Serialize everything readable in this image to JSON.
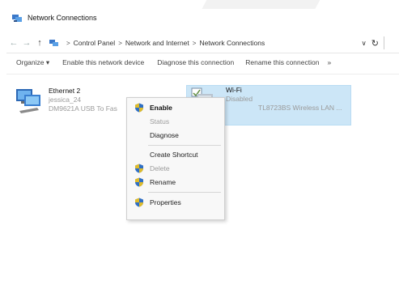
{
  "window": {
    "title": "Network Connections"
  },
  "address_bar": {
    "crumbs": [
      "Control Panel",
      "Network and Internet",
      "Network Connections"
    ],
    "sep": ">",
    "back": "←",
    "forward": "→",
    "up": "↑",
    "dropdown": "∨",
    "refresh": "↻"
  },
  "toolbar": {
    "organize": "Organize ▾",
    "enable": "Enable this network device",
    "diagnose": "Diagnose this connection",
    "rename": "Rename this connection",
    "more": "»"
  },
  "items": [
    {
      "name": "Ethernet 2",
      "status": "jessica_24",
      "device": "DM9621A USB To Fas"
    },
    {
      "name": "Wi-Fi",
      "status": "Disabled",
      "device": "TL8723BS Wireless LAN ..."
    }
  ],
  "context_menu": {
    "enable": "Enable",
    "status": "Status",
    "diagnose": "Diagnose",
    "create_shortcut": "Create Shortcut",
    "delete": "Delete",
    "rename": "Rename",
    "properties": "Properties"
  },
  "colors": {
    "selection": "#cce6f7",
    "menu_bg": "#f8f8f8",
    "shield_blue": "#2f6fc4",
    "shield_yellow": "#f2c31b"
  }
}
